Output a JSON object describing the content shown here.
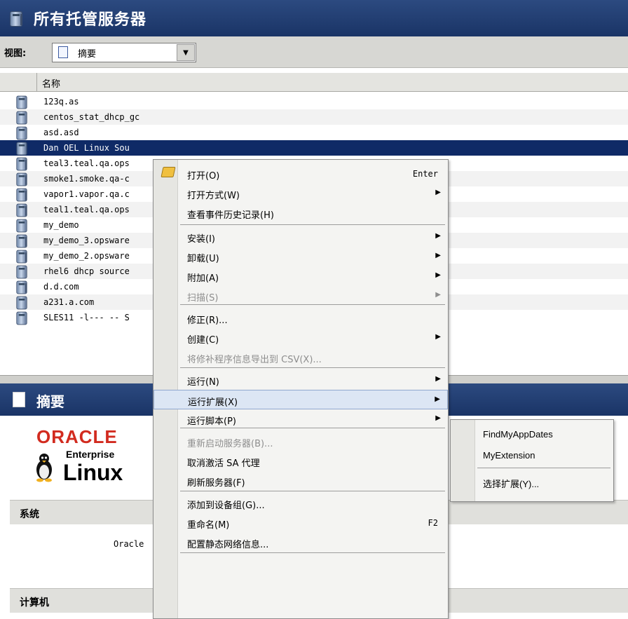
{
  "title": "所有托管服务器",
  "view": {
    "label": "视图:",
    "selected": "摘要"
  },
  "table": {
    "column": "名称",
    "rows": [
      {
        "name": "123q.as",
        "icon": "server-icon"
      },
      {
        "name": "centos_stat_dhcp_gc",
        "icon": "server-icon"
      },
      {
        "name": "asd.asd",
        "icon": "server-icon"
      },
      {
        "name": "Dan OEL Linux Sou",
        "icon": "server-icon",
        "selected": true
      },
      {
        "name": "teal3.teal.qa.ops",
        "icon": "server-group-icon"
      },
      {
        "name": "smoke1.smoke.qa-c",
        "icon": "server-group-icon"
      },
      {
        "name": "vapor1.vapor.qa.c",
        "icon": "server-group-icon"
      },
      {
        "name": "teal1.teal.qa.ops",
        "icon": "server-group-icon"
      },
      {
        "name": "my_demo",
        "icon": "server-icon"
      },
      {
        "name": "my_demo_3.opsware",
        "icon": "server-group-icon"
      },
      {
        "name": "my_demo_2.opsware",
        "icon": "server-group-icon"
      },
      {
        "name": "rhel6 dhcp source",
        "icon": "server-icon"
      },
      {
        "name": "d.d.com",
        "icon": "server-group-icon"
      },
      {
        "name": "a231.a.com",
        "icon": "server-icon"
      },
      {
        "name": "SLES11 -l--- -- S",
        "icon": "server-icon"
      }
    ]
  },
  "summary": {
    "title": "摘要",
    "logo": {
      "oracle": "ORACLE",
      "enterprise": "Enterprise",
      "linux": "Linux"
    },
    "section_system": "系统",
    "system_value": "Oracle",
    "section_computer": "计算机"
  },
  "menu": {
    "items": [
      {
        "label": "打开(O)",
        "shortcut": "Enter",
        "icon": "folder-icon"
      },
      {
        "label": "打开方式(W)",
        "submenu": true
      },
      {
        "label": "查看事件历史记录(H)"
      },
      {
        "label": "安装(I)",
        "submenu": true
      },
      {
        "label": "卸载(U)",
        "submenu": true
      },
      {
        "label": "附加(A)",
        "submenu": true
      },
      {
        "label": "扫描(S)",
        "submenu": true,
        "disabled": true
      },
      {
        "label": "修正(R)..."
      },
      {
        "label": "创建(C)",
        "submenu": true
      },
      {
        "label": "将修补程序信息导出到 CSV(X)...",
        "disabled": true
      },
      {
        "label": "运行(N)",
        "submenu": true
      },
      {
        "label": "运行扩展(X)",
        "submenu": true,
        "highlighted": true
      },
      {
        "label": "运行脚本(P)",
        "submenu": true
      },
      {
        "label": "重新启动服务器(B)...",
        "disabled": true
      },
      {
        "label": "取消激活 SA 代理"
      },
      {
        "label": "刷新服务器(F)"
      },
      {
        "label": "添加到设备组(G)..."
      },
      {
        "label": "重命名(M)",
        "shortcut": "F2"
      },
      {
        "label": "配置静态网络信息..."
      }
    ],
    "submenu": {
      "items": [
        "FindMyAppDates",
        "MyExtension",
        "选择扩展(Y)..."
      ]
    }
  },
  "colors": {
    "titlebar": "#1a3466",
    "selected_row": "#0f2a66",
    "oracle_red": "#d22b1f"
  }
}
